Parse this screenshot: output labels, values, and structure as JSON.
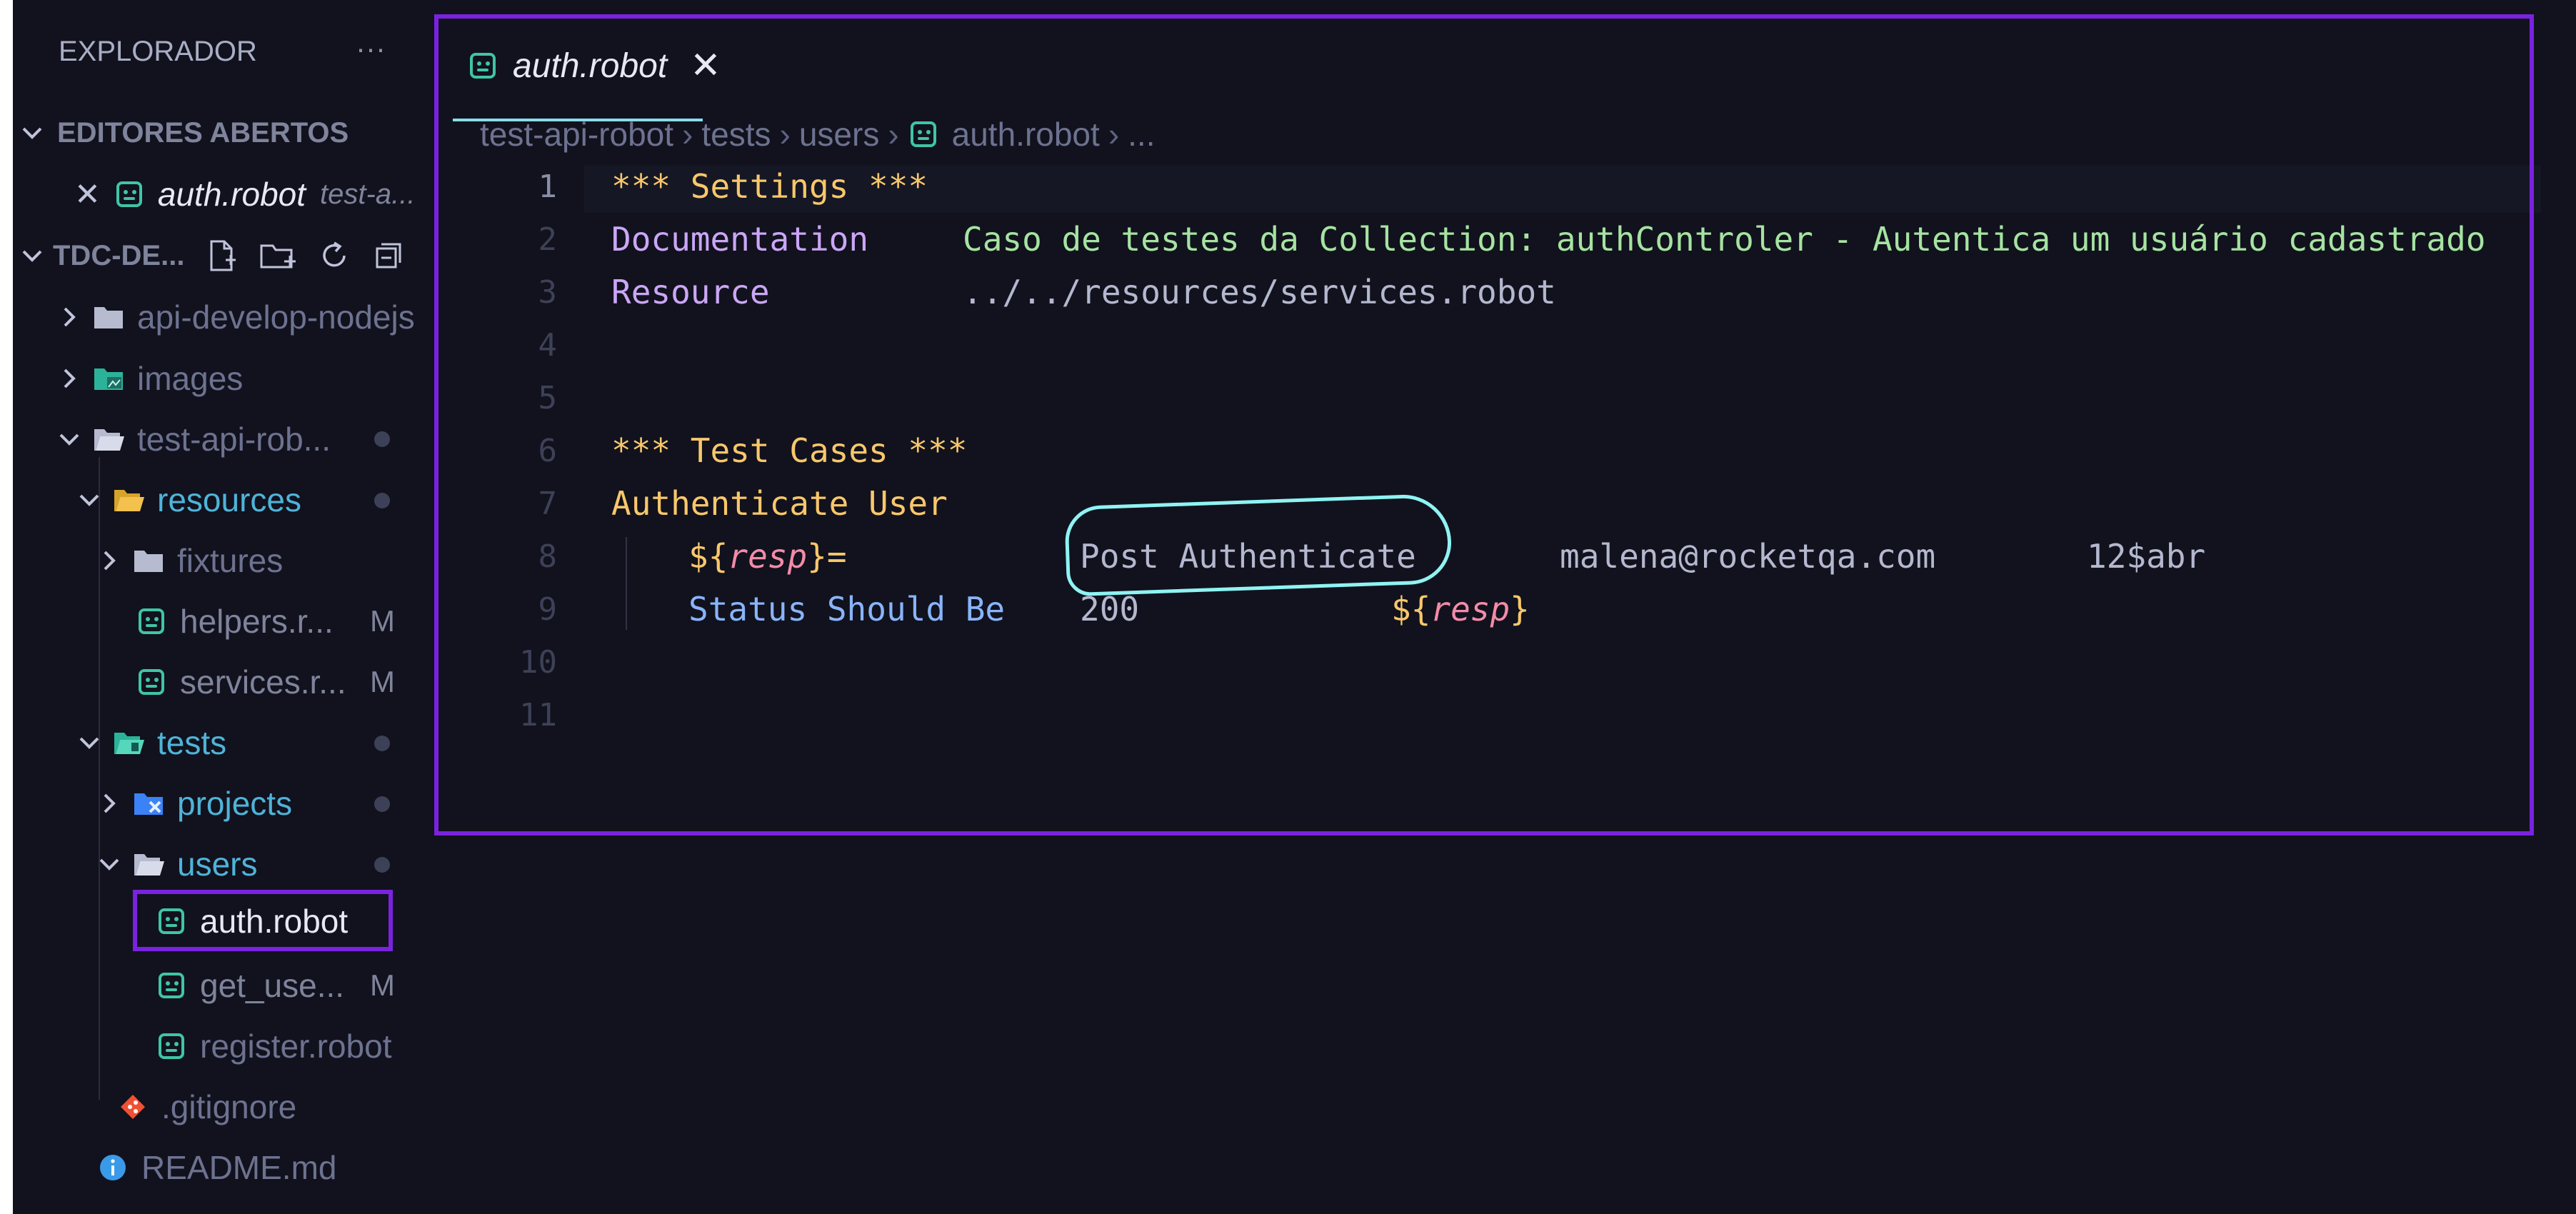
{
  "sidebar": {
    "title": "EXPLORADOR",
    "more": "···",
    "open_editors": {
      "title": "EDITORES ABERTOS",
      "items": [
        {
          "name": "auth.robot",
          "path": "test-a..."
        }
      ]
    },
    "workspace": {
      "title": "TDC-DE...",
      "tree": [
        {
          "label": "api-develop-nodejs"
        },
        {
          "label": "images"
        },
        {
          "label": "test-api-rob..."
        },
        {
          "label": "resources"
        },
        {
          "label": "fixtures"
        },
        {
          "label": "helpers.r...",
          "badge": "M"
        },
        {
          "label": "services.r...",
          "badge": "M"
        },
        {
          "label": "tests"
        },
        {
          "label": "projects"
        },
        {
          "label": "users"
        },
        {
          "label": "auth.robot"
        },
        {
          "label": "get_use...",
          "badge": "M"
        },
        {
          "label": "register.robot"
        },
        {
          "label": ".gitignore"
        },
        {
          "label": "README.md"
        }
      ]
    }
  },
  "editor": {
    "tab": {
      "label": "auth.robot",
      "close": "✕"
    },
    "breadcrumb": [
      "test-api-robot",
      "tests",
      "users",
      "auth.robot",
      "..."
    ],
    "line_numbers": [
      "1",
      "2",
      "3",
      "4",
      "5",
      "6",
      "7",
      "8",
      "9",
      "10",
      "11"
    ],
    "code": {
      "l1": "*** Settings ***",
      "l2_kw": "Documentation",
      "l2_val": "Caso de testes da Collection: authControler - Autentica um usuário cadastrado",
      "l3_kw": "Resource",
      "l3_val": "../../resources/services.robot",
      "l6": "*** Test Cases ***",
      "l7": "Authenticate User",
      "l8_var_open": "${",
      "l8_var_name": "resp",
      "l8_var_close": "}=",
      "l8_kw": "Post Authenticate",
      "l8_arg1": "malena@rocketqa.com",
      "l8_arg2": "12$abr",
      "l9_kw": "Status Should Be",
      "l9_arg1": "200",
      "l9_var_open": "${",
      "l9_var_name": "resp",
      "l9_var_close": "}"
    }
  },
  "colors": {
    "highlight_frame": "#7a22e0",
    "annotation_circle": "#8ff3f3"
  }
}
